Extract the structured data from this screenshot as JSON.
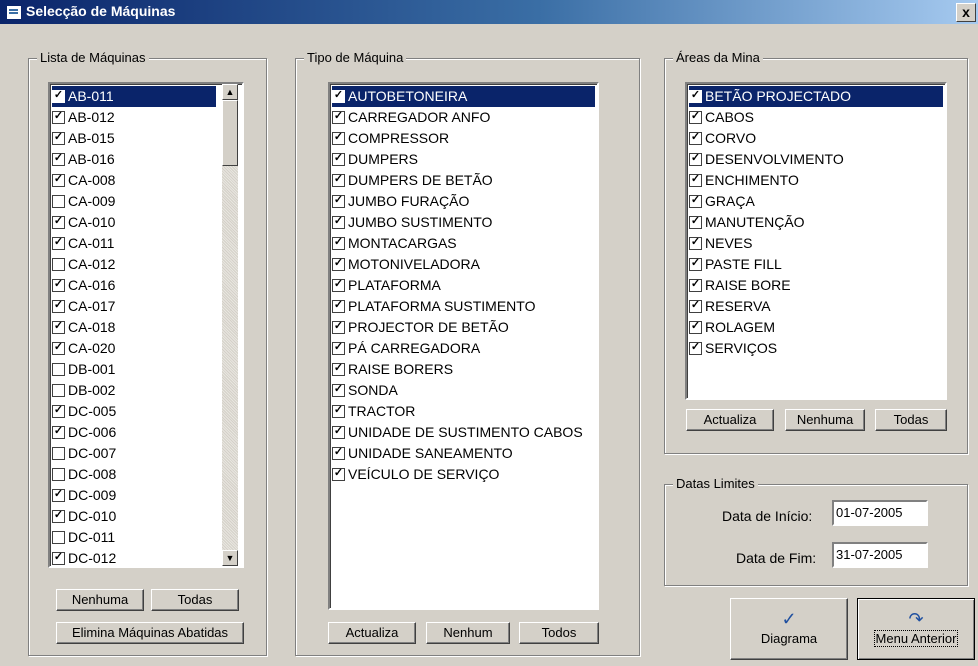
{
  "window": {
    "title": "Selecção de Máquinas",
    "close_label": "x"
  },
  "maquinas": {
    "legend": "Lista de Máquinas",
    "items": [
      {
        "label": "AB-011",
        "checked": true,
        "selected": true
      },
      {
        "label": "AB-012",
        "checked": true
      },
      {
        "label": "AB-015",
        "checked": true
      },
      {
        "label": "AB-016",
        "checked": true
      },
      {
        "label": "CA-008",
        "checked": true
      },
      {
        "label": "CA-009",
        "checked": false
      },
      {
        "label": "CA-010",
        "checked": true
      },
      {
        "label": "CA-011",
        "checked": true
      },
      {
        "label": "CA-012",
        "checked": false
      },
      {
        "label": "CA-016",
        "checked": true
      },
      {
        "label": "CA-017",
        "checked": true
      },
      {
        "label": "CA-018",
        "checked": true
      },
      {
        "label": "CA-020",
        "checked": true
      },
      {
        "label": "DB-001",
        "checked": false
      },
      {
        "label": "DB-002",
        "checked": false
      },
      {
        "label": "DC-005",
        "checked": true
      },
      {
        "label": "DC-006",
        "checked": true
      },
      {
        "label": "DC-007",
        "checked": false
      },
      {
        "label": "DC-008",
        "checked": false
      },
      {
        "label": "DC-009",
        "checked": true
      },
      {
        "label": "DC-010",
        "checked": true
      },
      {
        "label": "DC-011",
        "checked": false
      },
      {
        "label": "DC-012",
        "checked": true
      }
    ],
    "btn_nenhuma": "Nenhuma",
    "btn_todas": "Todas",
    "btn_elimina": "Elimina Máquinas Abatidas"
  },
  "tipos": {
    "legend": "Tipo de Máquina",
    "items": [
      {
        "label": "AUTOBETONEIRA",
        "checked": true,
        "selected": true
      },
      {
        "label": "CARREGADOR ANFO",
        "checked": true
      },
      {
        "label": "COMPRESSOR",
        "checked": true
      },
      {
        "label": "DUMPERS",
        "checked": true
      },
      {
        "label": "DUMPERS DE BETÃO",
        "checked": true
      },
      {
        "label": "JUMBO FURAÇÃO",
        "checked": true
      },
      {
        "label": "JUMBO SUSTIMENTO",
        "checked": true
      },
      {
        "label": "MONTACARGAS",
        "checked": true
      },
      {
        "label": "MOTONIVELADORA",
        "checked": true
      },
      {
        "label": "PLATAFORMA",
        "checked": true
      },
      {
        "label": "PLATAFORMA SUSTIMENTO",
        "checked": true
      },
      {
        "label": "PROJECTOR DE BETÃO",
        "checked": true
      },
      {
        "label": "PÁ CARREGADORA",
        "checked": true
      },
      {
        "label": "RAISE  BORERS",
        "checked": true
      },
      {
        "label": "SONDA",
        "checked": true
      },
      {
        "label": "TRACTOR",
        "checked": true
      },
      {
        "label": "UNIDADE DE SUSTIMENTO CABOS",
        "checked": true
      },
      {
        "label": "UNIDADE SANEAMENTO",
        "checked": true
      },
      {
        "label": "VEÍCULO DE SERVIÇO",
        "checked": true
      }
    ],
    "btn_actualiza": "Actualiza",
    "btn_nenhum": "Nenhum",
    "btn_todos": "Todos"
  },
  "areas": {
    "legend": "Áreas da Mina",
    "items": [
      {
        "label": "BETÃO PROJECTADO",
        "checked": true,
        "selected": true
      },
      {
        "label": "CABOS",
        "checked": true
      },
      {
        "label": "CORVO",
        "checked": true
      },
      {
        "label": "DESENVOLVIMENTO",
        "checked": true
      },
      {
        "label": "ENCHIMENTO",
        "checked": true
      },
      {
        "label": "GRAÇA",
        "checked": true
      },
      {
        "label": "MANUTENÇÃO",
        "checked": true
      },
      {
        "label": "NEVES",
        "checked": true
      },
      {
        "label": "PASTE FILL",
        "checked": true
      },
      {
        "label": "RAISE BORE",
        "checked": true
      },
      {
        "label": "RESERVA",
        "checked": true
      },
      {
        "label": "ROLAGEM",
        "checked": true
      },
      {
        "label": "SERVIÇOS",
        "checked": true
      }
    ],
    "btn_actualiza": "Actualiza",
    "btn_nenhuma": "Nenhuma",
    "btn_todas": "Todas"
  },
  "datas": {
    "legend": "Datas Limites",
    "inicio_label": "Data de Início:",
    "inicio_value": "01-07-2005",
    "fim_label": "Data de Fim:",
    "fim_value": "31-07-2005"
  },
  "actions": {
    "diagrama_label": "Diagrama",
    "diagrama_icon": "checkmark-icon",
    "menu_label": "Menu Anterior",
    "menu_icon": "return-arrow-icon"
  }
}
